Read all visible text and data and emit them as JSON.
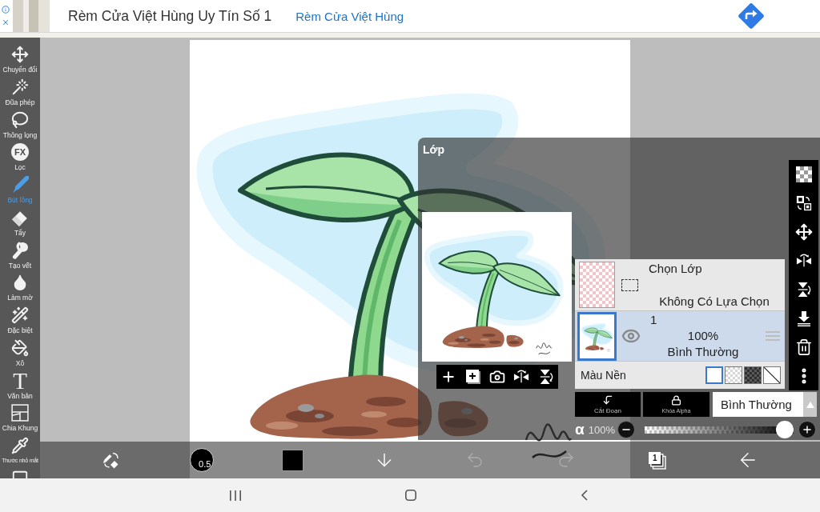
{
  "ad_banner": {
    "title": "Rèm Cửa Việt Hùng Uy Tín Số 1",
    "link": "Rèm Cửa Việt Hùng"
  },
  "tool_sidebar": {
    "items": [
      {
        "label": "Chuyển đổi",
        "selected": false
      },
      {
        "label": "Đũa phép",
        "selected": false
      },
      {
        "label": "Thông lọng",
        "selected": false
      },
      {
        "label": "Lọc",
        "glyph": "FX",
        "selected": false
      },
      {
        "label": "Bút lông",
        "selected": true
      },
      {
        "label": "Tẩy",
        "selected": false
      },
      {
        "label": "Tạo vết",
        "selected": false
      },
      {
        "label": "Làm mờ",
        "selected": false
      },
      {
        "label": "Đặc biệt",
        "selected": false
      },
      {
        "label": "Xô",
        "selected": false
      },
      {
        "label": "Văn bản",
        "glyph": "T",
        "selected": false
      },
      {
        "label": "Chia Khung",
        "selected": false
      },
      {
        "label": "Thước nhỏ mắt",
        "selected": false
      },
      {
        "selected": false
      }
    ]
  },
  "layer_panel": {
    "title": "Lớp",
    "selection": {
      "name": "Chọn Lớp",
      "status": "Không Có Lựa Chọn"
    },
    "layers": [
      {
        "name": "1",
        "opacity": "100%",
        "blend_mode": "Bình Thường",
        "visible": true,
        "selected": true
      }
    ],
    "background": {
      "label": "Màu Nền",
      "swatches": [
        {
          "kind": "white",
          "selected": true
        },
        {
          "kind": "checker",
          "selected": false
        },
        {
          "kind": "dark",
          "selected": false
        },
        {
          "kind": "none",
          "selected": false
        }
      ]
    },
    "actions": [
      {
        "kind": "clip",
        "label": "Cắt Đoạn"
      },
      {
        "kind": "lock",
        "label": "Khóa Alpha"
      }
    ],
    "blend_mode": "Bình Thường",
    "opacity": {
      "symbol": "α",
      "reading": "100%",
      "level": 1
    }
  },
  "bottom_toolbar": {
    "items": [
      {
        "kind": "swap",
        "disabled": false
      },
      {
        "kind": "size",
        "text": "0.5",
        "disabled": false
      },
      {
        "kind": "color",
        "color": "#000000",
        "disabled": false
      },
      {
        "kind": "down",
        "disabled": false
      },
      {
        "kind": "undo",
        "disabled": true
      },
      {
        "kind": "redo",
        "disabled": true
      },
      {
        "kind": "layers",
        "text": "1",
        "disabled": false
      },
      {
        "kind": "back",
        "disabled": false
      }
    ]
  }
}
